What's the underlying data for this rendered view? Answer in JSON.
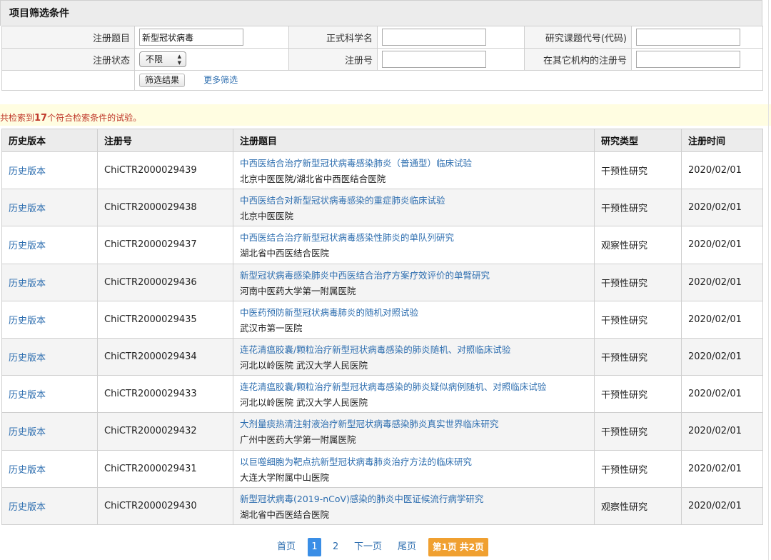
{
  "filter": {
    "title": "项目筛选条件",
    "reg_title_label": "注册题目",
    "reg_title_value": "新型冠状病毒",
    "sci_name_label": "正式科学名",
    "sci_name_value": "",
    "topic_code_label": "研究课题代号(代码)",
    "topic_code_value": "",
    "status_label": "注册状态",
    "status_value": "不限",
    "reg_no_label": "注册号",
    "reg_no_value": "",
    "other_reg_label": "在其它机构的注册号",
    "other_reg_value": "",
    "filter_button": "筛选结果",
    "more_filter": "更多筛选"
  },
  "result": {
    "prefix": "共检索到",
    "count": "17",
    "suffix": "个符合检索条件的试验。"
  },
  "table": {
    "headers": [
      "历史版本",
      "注册号",
      "注册题目",
      "研究类型",
      "注册时间"
    ],
    "rows": [
      {
        "history": "历史版本",
        "reg_no": "ChiCTR2000029439",
        "title": "中西医结合治疗新型冠状病毒感染肺炎（普通型）临床试验",
        "institution": "北京中医医院/湖北省中西医结合医院",
        "type": "干预性研究",
        "date": "2020/02/01"
      },
      {
        "history": "历史版本",
        "reg_no": "ChiCTR2000029438",
        "title": "中西医结合对新型冠状病毒感染的重症肺炎临床试验",
        "institution": "北京中医医院",
        "type": "干预性研究",
        "date": "2020/02/01"
      },
      {
        "history": "历史版本",
        "reg_no": "ChiCTR2000029437",
        "title": "中西医结合治疗新型冠状病毒感染性肺炎的单队列研究",
        "institution": "湖北省中西医结合医院",
        "type": "观察性研究",
        "date": "2020/02/01"
      },
      {
        "history": "历史版本",
        "reg_no": "ChiCTR2000029436",
        "title": "新型冠状病毒感染肺炎中西医结合治疗方案疗效评价的单臂研究",
        "institution": "河南中医药大学第一附属医院",
        "type": "干预性研究",
        "date": "2020/02/01"
      },
      {
        "history": "历史版本",
        "reg_no": "ChiCTR2000029435",
        "title": "中医药预防新型冠状病毒肺炎的随机对照试验",
        "institution": "武汉市第一医院",
        "type": "干预性研究",
        "date": "2020/02/01"
      },
      {
        "history": "历史版本",
        "reg_no": "ChiCTR2000029434",
        "title": "连花清瘟胶囊/颗粒治疗新型冠状病毒感染的肺炎随机、对照临床试验",
        "institution": "河北以岭医院 武汉大学人民医院",
        "type": "干预性研究",
        "date": "2020/02/01"
      },
      {
        "history": "历史版本",
        "reg_no": "ChiCTR2000029433",
        "title": "连花清瘟胶囊/颗粒治疗新型冠状病毒感染的肺炎疑似病例随机、对照临床试验",
        "institution": "河北以岭医院 武汉大学人民医院",
        "type": "干预性研究",
        "date": "2020/02/01"
      },
      {
        "history": "历史版本",
        "reg_no": "ChiCTR2000029432",
        "title": "大剂量痰热清注射液治疗新型冠状病毒感染肺炎真实世界临床研究",
        "institution": "广州中医药大学第一附属医院",
        "type": "干预性研究",
        "date": "2020/02/01"
      },
      {
        "history": "历史版本",
        "reg_no": "ChiCTR2000029431",
        "title": "以巨噬细胞为靶点抗新型冠状病毒肺炎治疗方法的临床研究",
        "institution": "大连大学附属中山医院",
        "type": "干预性研究",
        "date": "2020/02/01"
      },
      {
        "history": "历史版本",
        "reg_no": "ChiCTR2000029430",
        "title": "新型冠状病毒(2019-nCoV)感染的肺炎中医证候流行病学研究",
        "institution": "湖北省中西医结合医院",
        "type": "观察性研究",
        "date": "2020/02/01"
      }
    ]
  },
  "pager": {
    "first": "首页",
    "page1": "1",
    "page2": "2",
    "next": "下一页",
    "last": "尾页",
    "info": "第1页 共2页"
  },
  "colors": {
    "link": "#2f6fb0",
    "result_count": "#c0392b",
    "result_bg": "#fffde1",
    "pager_current": "#3a8ee6",
    "pager_info": "#f0a030"
  }
}
